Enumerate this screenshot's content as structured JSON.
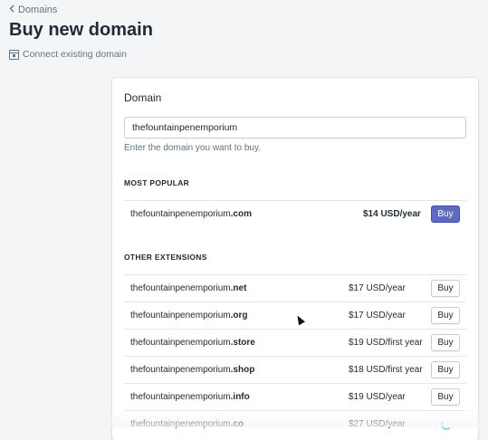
{
  "header": {
    "back_label": "Domains",
    "title": "Buy new domain",
    "connect_label": "Connect existing domain"
  },
  "card": {
    "title": "Domain",
    "input_value": "thefountainpenemporium",
    "help_text": "Enter the domain you want to buy."
  },
  "popular": {
    "heading": "MOST POPULAR",
    "rows": [
      {
        "base": "thefountainpenemporium",
        "ext": ".com",
        "price": "$14 USD/year",
        "button": "Buy"
      }
    ]
  },
  "other": {
    "heading": "OTHER EXTENSIONS",
    "rows": [
      {
        "base": "thefountainpenemporium",
        "ext": ".net",
        "price": "$17 USD/year",
        "button": "Buy"
      },
      {
        "base": "thefountainpenemporium",
        "ext": ".org",
        "price": "$17 USD/year",
        "button": "Buy"
      },
      {
        "base": "thefountainpenemporium",
        "ext": ".store",
        "price": "$19 USD/first year",
        "button": "Buy"
      },
      {
        "base": "thefountainpenemporium",
        "ext": ".shop",
        "price": "$18 USD/first year",
        "button": "Buy"
      },
      {
        "base": "thefountainpenemporium",
        "ext": ".info",
        "price": "$19 USD/year",
        "button": "Buy"
      },
      {
        "base": "thefountainpenemporium",
        "ext": ".co",
        "price": "$27 USD/year",
        "button": ""
      }
    ]
  },
  "colors": {
    "primary_button": "#5c6ac4",
    "spinner": "#47c1bf"
  }
}
